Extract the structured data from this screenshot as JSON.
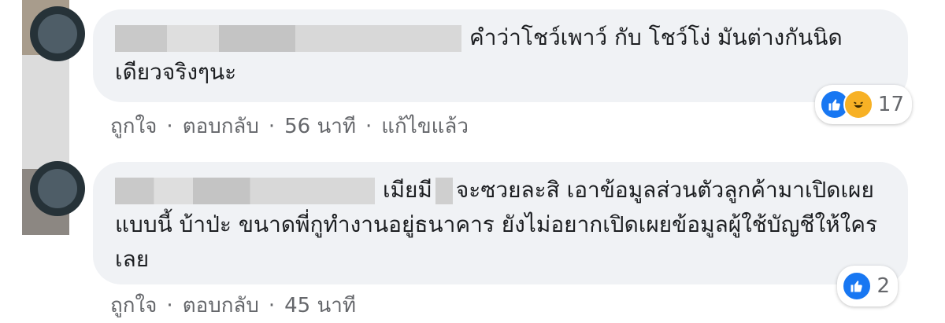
{
  "comments": [
    {
      "text": "คำว่าโชว์เพาว์ กับ โชว์โง่ มันต่างกันนิดเดียวจริงๆนะ",
      "reactions_count": "17",
      "actions": {
        "like": "ถูกใจ",
        "reply": "ตอบกลับ",
        "time": "56 นาที",
        "edited": "แก้ไขแล้ว"
      }
    },
    {
      "text_before_redact": "เมียมี",
      "text_after_redact": "จะซวยละสิ เอาข้อมูลส่วนตัวลูกค้ามาเปิดเผยแบบนี้ บ้าป่ะ ขนาดพี่กูทำงานอยู่ธนาคาร ยังไม่อยากเปิดเผยข้อมูลผู้ใช้บัญชีให้ใครเลย",
      "reactions_count": "2",
      "actions": {
        "like": "ถูกใจ",
        "reply": "ตอบกลับ",
        "time": "45 นาที"
      }
    }
  ],
  "separator": "·",
  "icons": {
    "like": "like-icon",
    "haha": "haha-icon"
  },
  "colors": {
    "bubble": "#f0f2f5",
    "meta_text": "#65676b",
    "like_blue": "#1877f2",
    "haha_yellow": "#f7b125"
  }
}
